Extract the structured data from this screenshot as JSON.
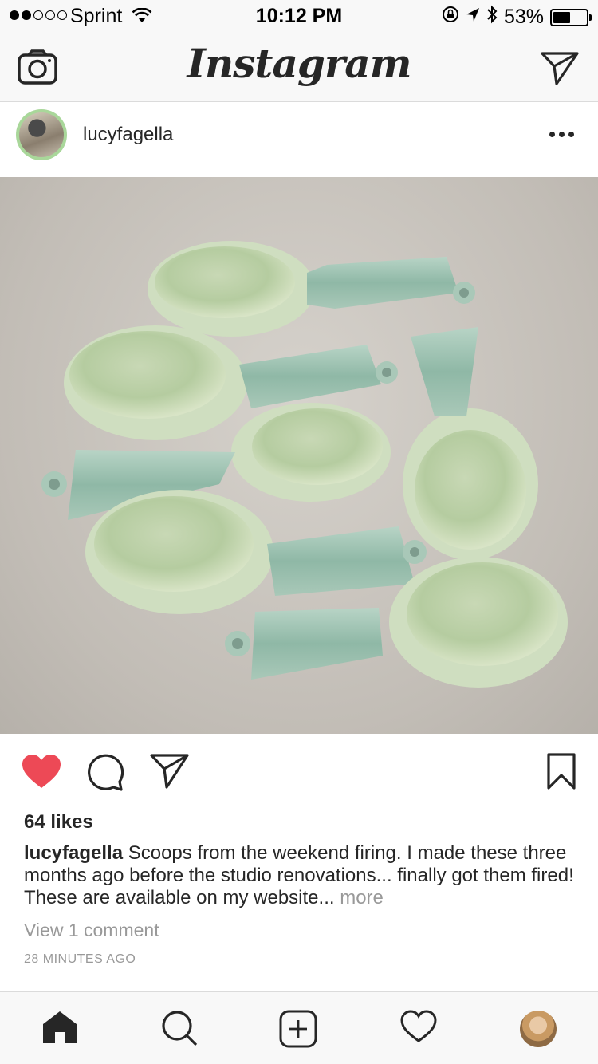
{
  "status_bar": {
    "carrier": "Sprint",
    "time": "10:12 PM",
    "battery_percent": "53%",
    "battery_level": 0.53,
    "signal_bars_filled": 2,
    "signal_bars_total": 5
  },
  "nav": {
    "title": "Instagram",
    "icons": [
      "camera-icon",
      "direct-message-icon"
    ]
  },
  "post": {
    "username": "lucyfagella",
    "likes": "64 likes",
    "caption_user": "lucyfagella",
    "caption_text": " Scoops from the weekend firing. I made these three months ago before the studio renovations... finally got them fired! These are available on my website...",
    "caption_more": " more",
    "view_comments": "View 1 comment",
    "time_ago": "28 MINUTES AGO",
    "liked": true,
    "like_color": "#ed4956"
  },
  "tab_bar": {
    "tabs": [
      "home-icon",
      "search-icon",
      "new-post-icon",
      "activity-icon",
      "profile-avatar"
    ]
  },
  "colors": {
    "bar_background": "#f8f8f8",
    "secondary_text": "#999999",
    "scoop_glaze": "#cfe0c4",
    "handle_glaze": "#a8c9b8"
  }
}
